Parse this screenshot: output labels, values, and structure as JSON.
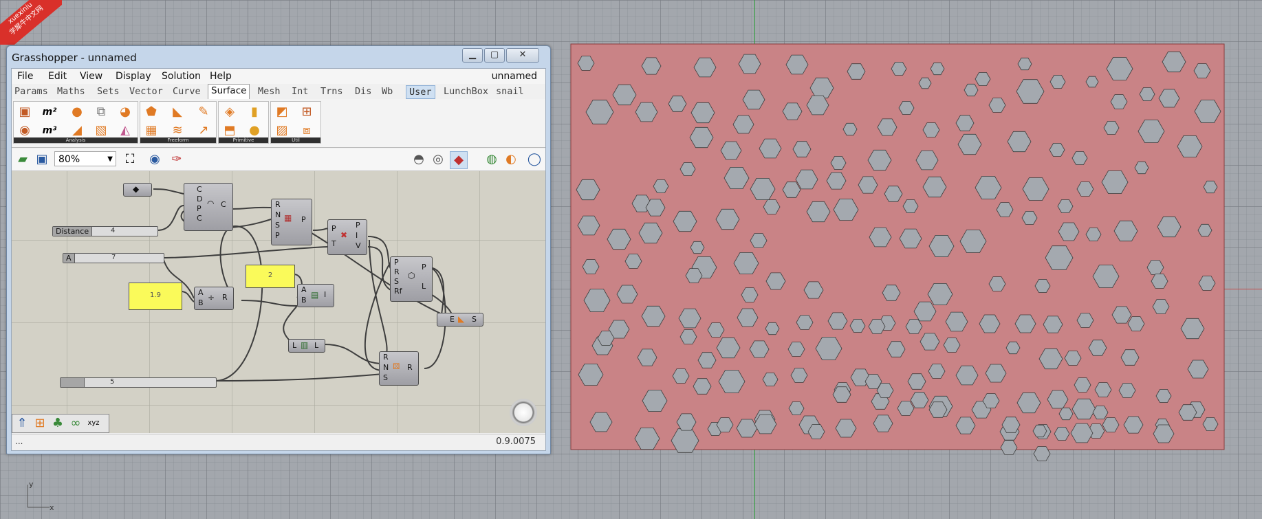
{
  "watermark": {
    "line1": "xuexiniu",
    "line2": "学犀牛中文网"
  },
  "axis": {
    "x_label": "x",
    "y_label": "y"
  },
  "viewport": {
    "panel_fill": "#c98386",
    "panel_stroke": "#8a3a3a",
    "hole_fill": "#a4a9af",
    "hole_stroke": "#3d3d3d"
  },
  "gh": {
    "title": "Grasshopper - unnamed",
    "window_buttons": {
      "minimize": "▁",
      "maximize": "▢",
      "close": "✕"
    },
    "menu": [
      "File",
      "Edit",
      "View",
      "Display",
      "Solution",
      "Help"
    ],
    "doc_name": "unnamed",
    "tabs": [
      "Params",
      "Maths",
      "Sets",
      "Vector",
      "Curve",
      "Surface",
      "Mesh",
      "Int",
      "Trns",
      "Dis",
      "Wb",
      "User",
      "LunchBox",
      "snail"
    ],
    "active_tab": "Surface",
    "highlight_tab": "User",
    "ribbon_groups": [
      "Analysis",
      "Freeform",
      "Primitive",
      "Util"
    ],
    "zoom": "80%",
    "status_left": "...",
    "version": "0.9.0075",
    "canvas": {
      "slider_distance": {
        "label": "Distance",
        "value": "4"
      },
      "slider_a": {
        "label": "A",
        "value": "7"
      },
      "slider_bottom": {
        "value": "5"
      },
      "panel_2": "2",
      "panel_19": "1.9",
      "node_circle": {
        "inputs": [
          "C",
          "D",
          "P",
          "C"
        ],
        "output": "C"
      },
      "node_divide": {
        "inputs": [
          "R",
          "N",
          "S",
          "P"
        ],
        "output": "P"
      },
      "node_closest": {
        "inputs": [
          "P",
          "T"
        ],
        "outputs": [
          "P",
          "I",
          "V"
        ]
      },
      "node_polygon": {
        "inputs": [
          "P",
          "R",
          "S",
          "Rf"
        ],
        "outputs": [
          "P",
          "L"
        ]
      },
      "node_divide2": {
        "inputs": [
          "A",
          "B"
        ],
        "output": "R"
      },
      "node_smaller": {
        "inputs": [
          "A",
          "B"
        ],
        "output": "I"
      },
      "node_list": {
        "input": "L",
        "output": "L"
      },
      "node_random": {
        "inputs": [
          "R",
          "N",
          "S"
        ],
        "output": "R"
      },
      "node_extrude": {
        "input": "E",
        "output": "S"
      }
    }
  },
  "hexagons": [
    [
      852,
      92,
      12
    ],
    [
      947,
      96,
      14
    ],
    [
      1025,
      98,
      16
    ],
    [
      1090,
      93,
      16
    ],
    [
      1159,
      94,
      16
    ],
    [
      1195,
      128,
      17
    ],
    [
      1245,
      104,
      13
    ],
    [
      1307,
      100,
      11
    ],
    [
      1363,
      100,
      10
    ],
    [
      1429,
      115,
      11
    ],
    [
      1490,
      93,
      10
    ],
    [
      1538,
      119,
      11
    ],
    [
      1588,
      119,
      9
    ],
    [
      1628,
      100,
      19
    ],
    [
      1707,
      90,
      17
    ],
    [
      1748,
      103,
      12
    ],
    [
      1627,
      148,
      12
    ],
    [
      1668,
      137,
      11
    ],
    [
      1756,
      162,
      19
    ],
    [
      1700,
      143,
      15
    ],
    [
      1498,
      133,
      20
    ],
    [
      1412,
      131,
      10
    ],
    [
      1345,
      121,
      9
    ],
    [
      1318,
      157,
      11
    ],
    [
      1450,
      153,
      12
    ],
    [
      1403,
      179,
      13
    ],
    [
      1354,
      189,
      12
    ],
    [
      1290,
      185,
      14
    ],
    [
      1236,
      188,
      10
    ],
    [
      1189,
      153,
      16
    ],
    [
      1152,
      162,
      14
    ],
    [
      1096,
      145,
      16
    ],
    [
      1081,
      181,
      15
    ],
    [
      1022,
      164,
      17
    ],
    [
      985,
      151,
      13
    ],
    [
      940,
      163,
      16
    ],
    [
      908,
      138,
      17
    ],
    [
      872,
      163,
      20
    ],
    [
      1020,
      200,
      17
    ],
    [
      1120,
      216,
      16
    ],
    [
      1166,
      217,
      13
    ],
    [
      1219,
      237,
      11
    ],
    [
      1279,
      233,
      17
    ],
    [
      1348,
      233,
      16
    ],
    [
      1410,
      210,
      17
    ],
    [
      1482,
      206,
      17
    ],
    [
      1537,
      218,
      11
    ],
    [
      1570,
      230,
      11
    ],
    [
      1616,
      186,
      11
    ],
    [
      1674,
      191,
      19
    ],
    [
      1730,
      213,
      18
    ],
    [
      1660,
      244,
      10
    ],
    [
      1621,
      265,
      19
    ],
    [
      1578,
      275,
      12
    ],
    [
      1549,
      300,
      11
    ],
    [
      1506,
      275,
      19
    ],
    [
      1437,
      273,
      19
    ],
    [
      1359,
      272,
      17
    ],
    [
      1324,
      300,
      11
    ],
    [
      1299,
      282,
      13
    ],
    [
      1262,
      269,
      14
    ],
    [
      1216,
      263,
      14
    ],
    [
      1173,
      261,
      16
    ],
    [
      1109,
      275,
      18
    ],
    [
      1071,
      259,
      18
    ],
    [
      1063,
      219,
      15
    ],
    [
      1000,
      246,
      11
    ],
    [
      961,
      271,
      11
    ],
    [
      1058,
      319,
      17
    ],
    [
      1103,
      350,
      12
    ],
    [
      1122,
      301,
      12
    ],
    [
      1151,
      276,
      13
    ],
    [
      1190,
      308,
      17
    ],
    [
      1230,
      305,
      18
    ],
    [
      1280,
      345,
      16
    ],
    [
      1324,
      347,
      16
    ],
    [
      1369,
      358,
      18
    ],
    [
      1415,
      351,
      19
    ],
    [
      1461,
      305,
      12
    ],
    [
      1497,
      317,
      11
    ],
    [
      1554,
      337,
      15
    ],
    [
      1590,
      341,
      11
    ],
    [
      1637,
      336,
      17
    ],
    [
      1700,
      330,
      17
    ],
    [
      1760,
      272,
      10
    ],
    [
      1752,
      335,
      10
    ],
    [
      1680,
      389,
      12
    ],
    [
      1608,
      402,
      19
    ],
    [
      1540,
      375,
      20
    ],
    [
      1516,
      416,
      11
    ],
    [
      1450,
      413,
      12
    ],
    [
      1367,
      428,
      18
    ],
    [
      1296,
      426,
      13
    ],
    [
      1183,
      422,
      14
    ],
    [
      1128,
      409,
      14
    ],
    [
      1085,
      383,
      18
    ],
    [
      1024,
      389,
      18
    ],
    [
      946,
      339,
      17
    ],
    [
      900,
      348,
      17
    ],
    [
      921,
      380,
      12
    ],
    [
      1090,
      429,
      12
    ],
    [
      1087,
      462,
      15
    ],
    [
      1003,
      463,
      16
    ],
    [
      950,
      460,
      17
    ],
    [
      900,
      479,
      15
    ],
    [
      876,
      503,
      15
    ],
    [
      868,
      437,
      19
    ],
    [
      912,
      428,
      15
    ],
    [
      859,
      388,
      12
    ],
    [
      856,
      328,
      16
    ],
    [
      855,
      276,
      17
    ],
    [
      933,
      296,
      14
    ],
    [
      953,
      302,
      14
    ],
    [
      996,
      322,
      17
    ],
    [
      1014,
      360,
      10
    ],
    [
      1009,
      401,
      12
    ],
    [
      1041,
      480,
      12
    ],
    [
      1123,
      478,
      10
    ],
    [
      1170,
      469,
      12
    ],
    [
      1218,
      467,
      14
    ],
    [
      1247,
      474,
      11
    ],
    [
      1290,
      470,
      12
    ],
    [
      1303,
      508,
      13
    ],
    [
      1329,
      475,
      12
    ],
    [
      1345,
      453,
      16
    ],
    [
      1391,
      468,
      16
    ],
    [
      1439,
      471,
      15
    ],
    [
      1491,
      471,
      15
    ],
    [
      1531,
      472,
      14
    ],
    [
      1578,
      466,
      12
    ],
    [
      1631,
      458,
      14
    ],
    [
      1688,
      446,
      12
    ],
    [
      1686,
      409,
      12
    ],
    [
      1652,
      471,
      12
    ],
    [
      1596,
      506,
      13
    ],
    [
      1560,
      521,
      12
    ],
    [
      1528,
      522,
      17
    ],
    [
      1473,
      506,
      10
    ],
    [
      1384,
      502,
      12
    ],
    [
      1352,
      497,
      14
    ],
    [
      1275,
      475,
      12
    ],
    [
      1205,
      507,
      19
    ],
    [
      1158,
      508,
      12
    ],
    [
      1104,
      508,
      14
    ],
    [
      1059,
      506,
      17
    ],
    [
      990,
      547,
      12
    ],
    [
      1001,
      490,
      12
    ],
    [
      1028,
      524,
      13
    ],
    [
      1021,
      562,
      13
    ],
    [
      1064,
      555,
      19
    ],
    [
      1120,
      552,
      11
    ],
    [
      1162,
      546,
      12
    ],
    [
      1225,
      567,
      12
    ],
    [
      1251,
      549,
      14
    ],
    [
      1333,
      555,
      13
    ],
    [
      1337,
      582,
      13
    ],
    [
      1368,
      591,
      17
    ],
    [
      1427,
      596,
      14
    ],
    [
      1441,
      583,
      12
    ],
    [
      1496,
      586,
      17
    ],
    [
      1538,
      581,
      15
    ],
    [
      1574,
      560,
      12
    ],
    [
      1604,
      567,
      12
    ],
    [
      1639,
      568,
      12
    ],
    [
      1576,
      595,
      17
    ],
    [
      1550,
      602,
      10
    ],
    [
      1600,
      600,
      11
    ],
    [
      1643,
      520,
      13
    ],
    [
      1734,
      478,
      17
    ],
    [
      1755,
      412,
      12
    ],
    [
      1742,
      537,
      15
    ],
    [
      1739,
      596,
      13
    ],
    [
      1692,
      576,
      11
    ],
    [
      1690,
      618,
      10
    ],
    [
      1648,
      618,
      14
    ],
    [
      1594,
      627,
      12
    ],
    [
      1516,
      628,
      12
    ],
    [
      1468,
      628,
      14
    ],
    [
      1467,
      651,
      12
    ],
    [
      1470,
      618,
      13
    ],
    [
      1364,
      596,
      13
    ],
    [
      1317,
      594,
      12
    ],
    [
      1280,
      584,
      13
    ],
    [
      1230,
      623,
      15
    ],
    [
      1177,
      618,
      15
    ],
    [
      1112,
      610,
      15
    ],
    [
      1086,
      623,
      15
    ],
    [
      1040,
      624,
      11
    ],
    [
      996,
      641,
      20
    ],
    [
      941,
      638,
      18
    ],
    [
      874,
      614,
      16
    ],
    [
      859,
      545,
      18
    ],
    [
      881,
      492,
      12
    ],
    [
      941,
      520,
      14
    ],
    [
      952,
      583,
      18
    ],
    [
      998,
      614,
      14
    ],
    [
      1054,
      618,
      12
    ],
    [
      1113,
      617,
      16
    ],
    [
      1187,
      628,
      12
    ],
    [
      1224,
      574,
      13
    ],
    [
      1284,
      616,
      14
    ],
    [
      1404,
      619,
      14
    ],
    [
      1512,
      627,
      10
    ],
    [
      1573,
      630,
      16
    ],
    [
      1615,
      618,
      12
    ],
    [
      1692,
      631,
      15
    ],
    [
      1727,
      600,
      13
    ],
    [
      1760,
      617,
      11
    ],
    [
      1515,
      660,
      12
    ],
    [
      1544,
      631,
      11
    ],
    [
      1448,
      543,
      15
    ],
    [
      1406,
      546,
      16
    ],
    [
      1270,
      555,
      12
    ],
    [
      1287,
      568,
      12
    ],
    [
      1362,
      540,
      12
    ],
    [
      1158,
      594,
      11
    ]
  ]
}
